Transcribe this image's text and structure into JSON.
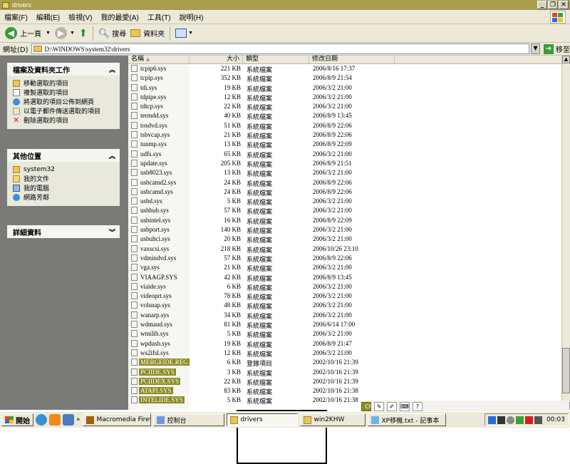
{
  "window": {
    "title": "drivers",
    "buttons": [
      "_",
      "❐",
      "✕"
    ]
  },
  "menu": [
    "檔案(F)",
    "編輯(E)",
    "檢視(V)",
    "我的最愛(A)",
    "工具(T)",
    "說明(H)"
  ],
  "toolbar": {
    "back": "上一頁",
    "search": "搜尋",
    "folders": "資料夾"
  },
  "address": {
    "label": "網址(D)",
    "value": "D:\\WINDOWS\\system32\\drivers",
    "go": "移至"
  },
  "panels": {
    "tasks": {
      "title": "檔案及資料夾工作",
      "items": [
        "移動選取的項目",
        "複製選取的項目",
        "將選取的項目公佈到網頁",
        "以電子郵件傳送選取的項目",
        "刪除選取的項目"
      ]
    },
    "places": {
      "title": "其他位置",
      "items": [
        "system32",
        "我的文件",
        "我的電腦",
        "網路芳鄰"
      ]
    },
    "details": {
      "title": "詳細資料"
    }
  },
  "columns": {
    "name": "名稱",
    "size": "大小",
    "type": "類型",
    "date": "修改日期"
  },
  "files": [
    {
      "name": "tcpip6.sys",
      "size": "221 KB",
      "type": "系統檔案",
      "date": "2006/8/16 17:37"
    },
    {
      "name": "tcpip.sys",
      "size": "352 KB",
      "type": "系統檔案",
      "date": "2006/8/9 21:54"
    },
    {
      "name": "tdi.sys",
      "size": "19 KB",
      "type": "系統檔案",
      "date": "2006/3/2 21:00"
    },
    {
      "name": "tdpipe.sys",
      "size": "12 KB",
      "type": "系統檔案",
      "date": "2006/3/2 21:00"
    },
    {
      "name": "tdtcp.sys",
      "size": "22 KB",
      "type": "系統檔案",
      "date": "2006/3/2 21:00"
    },
    {
      "name": "termdd.sys",
      "size": "40 KB",
      "type": "系統檔案",
      "date": "2006/8/9 13:45"
    },
    {
      "name": "tosdvd.sys",
      "size": "51 KB",
      "type": "系統檔案",
      "date": "2006/8/9 22:06"
    },
    {
      "name": "tsbvcap.sys",
      "size": "21 KB",
      "type": "系統檔案",
      "date": "2006/8/9 22:06"
    },
    {
      "name": "tunmp.sys",
      "size": "13 KB",
      "type": "系統檔案",
      "date": "2006/8/9 22:09"
    },
    {
      "name": "udfs.sys",
      "size": "65 KB",
      "type": "系統檔案",
      "date": "2006/3/2 21:00"
    },
    {
      "name": "update.sys",
      "size": "205 KB",
      "type": "系統檔案",
      "date": "2006/8/9 21:51"
    },
    {
      "name": "usb8023.sys",
      "size": "13 KB",
      "type": "系統檔案",
      "date": "2006/3/2 21:00"
    },
    {
      "name": "usbcamd2.sys",
      "size": "24 KB",
      "type": "系統檔案",
      "date": "2006/8/9 22:06"
    },
    {
      "name": "usbcamd.sys",
      "size": "24 KB",
      "type": "系統檔案",
      "date": "2006/8/9 22:06"
    },
    {
      "name": "usbd.sys",
      "size": "5 KB",
      "type": "系統檔案",
      "date": "2006/3/2 21:00"
    },
    {
      "name": "usbhub.sys",
      "size": "57 KB",
      "type": "系統檔案",
      "date": "2006/3/2 21:00"
    },
    {
      "name": "usbintel.sys",
      "size": "16 KB",
      "type": "系統檔案",
      "date": "2006/8/9 22:09"
    },
    {
      "name": "usbport.sys",
      "size": "140 KB",
      "type": "系統檔案",
      "date": "2006/3/2 21:00"
    },
    {
      "name": "usbuhci.sys",
      "size": "20 KB",
      "type": "系統檔案",
      "date": "2006/3/2 21:00"
    },
    {
      "name": "vaxscsi.sys",
      "size": "218 KB",
      "type": "系統檔案",
      "date": "2006/10/26 23:10"
    },
    {
      "name": "vdmindvd.sys",
      "size": "57 KB",
      "type": "系統檔案",
      "date": "2006/8/9 22:06"
    },
    {
      "name": "vga.sys",
      "size": "21 KB",
      "type": "系統檔案",
      "date": "2006/3/2 21:00"
    },
    {
      "name": "VIAAGP.SYS",
      "size": "42 KB",
      "type": "系統檔案",
      "date": "2006/8/9 13:45"
    },
    {
      "name": "viaide.sys",
      "size": "6 KB",
      "type": "系統檔案",
      "date": "2006/3/2 21:00"
    },
    {
      "name": "videoprt.sys",
      "size": "78 KB",
      "type": "系統檔案",
      "date": "2006/3/2 21:00"
    },
    {
      "name": "volsnap.sys",
      "size": "48 KB",
      "type": "系統檔案",
      "date": "2006/3/2 21:00"
    },
    {
      "name": "wanarp.sys",
      "size": "34 KB",
      "type": "系統檔案",
      "date": "2006/3/2 21:00"
    },
    {
      "name": "wdmaud.sys",
      "size": "81 KB",
      "type": "系統檔案",
      "date": "2006/6/14 17:00"
    },
    {
      "name": "wmilib.sys",
      "size": "5 KB",
      "type": "系統檔案",
      "date": "2006/3/2 21:00"
    },
    {
      "name": "wpdusb.sys",
      "size": "19 KB",
      "type": "系統檔案",
      "date": "2006/8/9 21:47"
    },
    {
      "name": "ws2ifsl.sys",
      "size": "12 KB",
      "type": "系統檔案",
      "date": "2006/3/2 21:00"
    },
    {
      "name": "MERGEIDE.REG",
      "size": "6 KB",
      "type": "登錄項目",
      "date": "2002/10/16 21:39",
      "selected": true
    },
    {
      "name": "PCIIDE.SYS",
      "size": "3 KB",
      "type": "系統檔案",
      "date": "2002/10/16 21:39",
      "selected": true
    },
    {
      "name": "PCIIDEX.SYS",
      "size": "22 KB",
      "type": "系統檔案",
      "date": "2002/10/16 21:39",
      "selected": true
    },
    {
      "name": "ATAPI.SYS",
      "size": "83 KB",
      "type": "系統檔案",
      "date": "2002/10/16 21:38",
      "selected": true
    },
    {
      "name": "INTELIDE.SYS",
      "size": "5 KB",
      "type": "系統檔案",
      "date": "2002/10/16 21:38",
      "selected": true
    }
  ],
  "ime": [
    "CH",
    "?"
  ],
  "taskbar": {
    "start": "開始",
    "tasks": [
      "Macromedia Firewo...",
      "控制台",
      "drivers",
      "win2KHW",
      "XP移機.txt - 記事本"
    ],
    "clock": "00:03"
  }
}
